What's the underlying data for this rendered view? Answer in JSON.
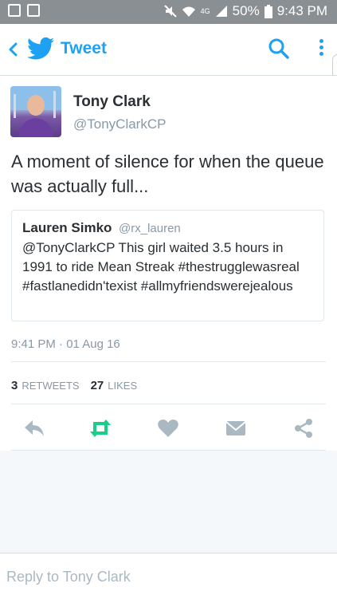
{
  "status_bar": {
    "battery": "50%",
    "time": "9:43 PM",
    "network": "4G"
  },
  "header": {
    "title": "Tweet"
  },
  "tweet": {
    "author_name": "Tony Clark",
    "author_handle": "@TonyClarkCP",
    "text": "A moment of silence for when the queue was actually full...",
    "quoted": {
      "author_name": "Lauren Simko",
      "author_handle": "@rx_lauren",
      "text": "@TonyClarkCP This girl waited 3.5 hours in 1991 to ride Mean Streak #thestrugglewasreal #fastlanedidn'texist #allmyfriendswerejealous"
    },
    "timestamp": "9:41 PM · 01 Aug 16",
    "retweets_count": "3",
    "retweets_label": "RETWEETS",
    "likes_count": "27",
    "likes_label": "LIKES"
  },
  "actions": [
    "reply-icon",
    "retweet-icon",
    "like-icon",
    "message-icon",
    "share-icon"
  ],
  "colors": {
    "brand": "#1da1f2",
    "retweet_active": "#19cf86",
    "icon_gray": "#aab8c2"
  },
  "reply": {
    "placeholder": "Reply to Tony Clark"
  }
}
